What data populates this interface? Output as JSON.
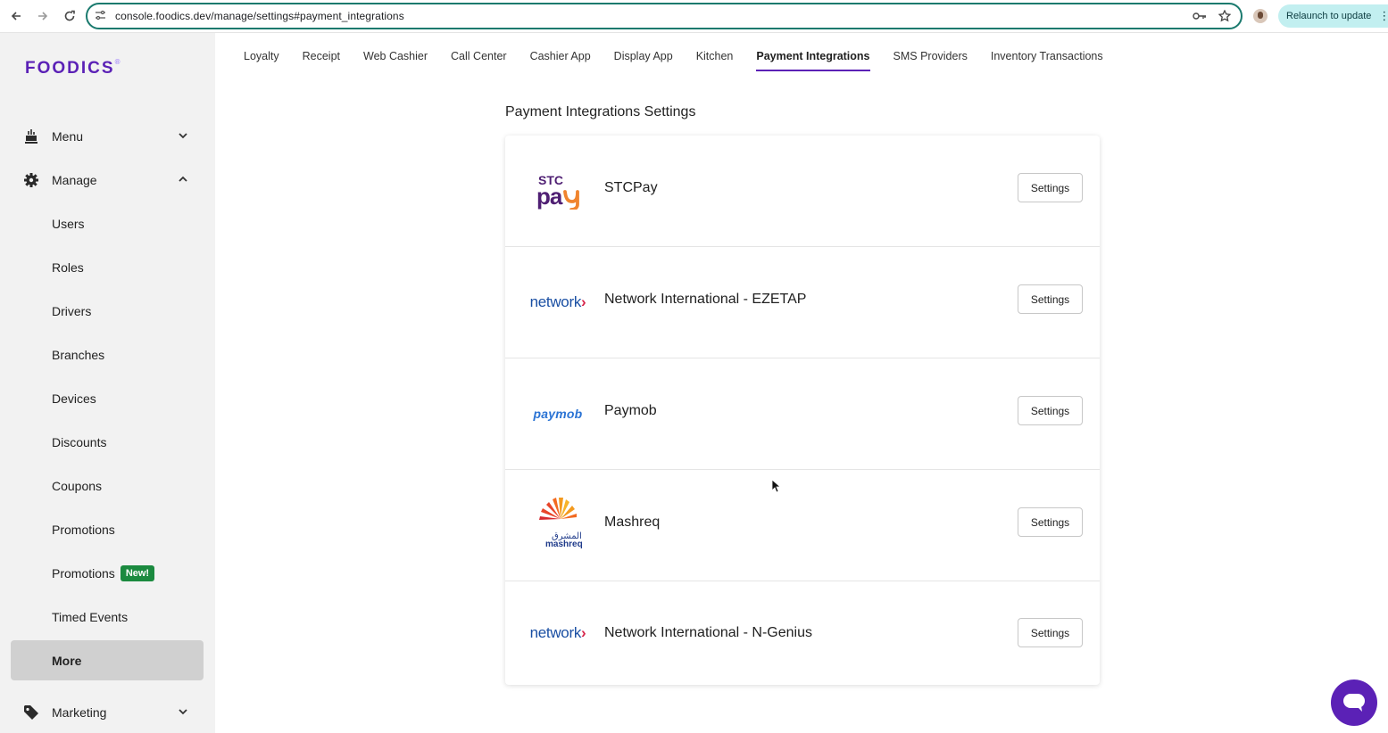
{
  "browser": {
    "url": "console.foodics.dev/manage/settings#payment_integrations",
    "relaunch_label": "Relaunch to update"
  },
  "sidebar": {
    "logo": "FOODICS",
    "items": [
      {
        "label": "Menu",
        "icon": "food-icon"
      },
      {
        "label": "Manage",
        "icon": "gear-icon"
      },
      {
        "label": "Marketing",
        "icon": "tag-icon"
      }
    ],
    "sub_items": [
      {
        "label": "Users"
      },
      {
        "label": "Roles"
      },
      {
        "label": "Drivers"
      },
      {
        "label": "Branches"
      },
      {
        "label": "Devices"
      },
      {
        "label": "Discounts"
      },
      {
        "label": "Coupons"
      },
      {
        "label": "Promotions"
      },
      {
        "label": "Promotions",
        "badge": "New!"
      },
      {
        "label": "Timed Events"
      },
      {
        "label": "More",
        "active": true
      }
    ]
  },
  "tabs": [
    {
      "label": "Loyalty"
    },
    {
      "label": "Receipt"
    },
    {
      "label": "Web Cashier"
    },
    {
      "label": "Call Center"
    },
    {
      "label": "Cashier App"
    },
    {
      "label": "Display App"
    },
    {
      "label": "Kitchen"
    },
    {
      "label": "Payment Integrations",
      "active": true
    },
    {
      "label": "SMS Providers"
    },
    {
      "label": "Inventory Transactions"
    }
  ],
  "main": {
    "title": "Payment Integrations Settings",
    "integrations": [
      {
        "name": "STCPay",
        "logo": "stcpay-logo",
        "button": "Settings"
      },
      {
        "name": "Network International - EZETAP",
        "logo": "network-logo",
        "logo_text": "network",
        "button": "Settings"
      },
      {
        "name": "Paymob",
        "logo": "paymob-logo",
        "logo_text": "paymob",
        "button": "Settings"
      },
      {
        "name": "Mashreq",
        "logo": "mashreq-logo",
        "button": "Settings"
      },
      {
        "name": "Network International - N-Genius",
        "logo": "network-logo",
        "logo_text": "network",
        "button": "Settings"
      }
    ]
  },
  "colors": {
    "brand": "#5b21b6",
    "badge": "#1b8a3f",
    "omnibox_border": "#1a7a6e"
  }
}
